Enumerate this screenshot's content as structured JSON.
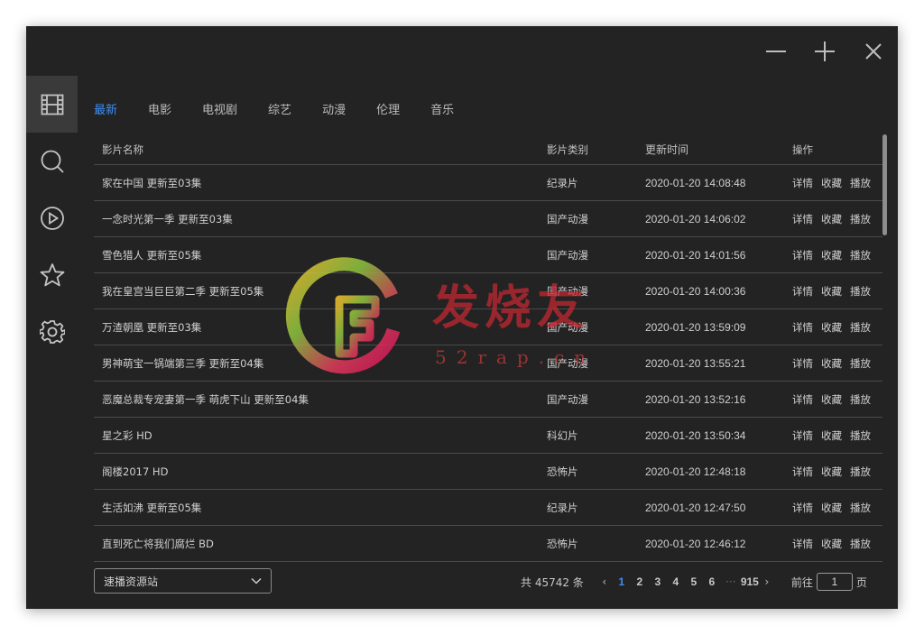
{
  "window_controls": [
    {
      "name": "minimize",
      "icon": "minus-icon"
    },
    {
      "name": "maximize",
      "icon": "plus-icon"
    },
    {
      "name": "close",
      "icon": "close-icon"
    }
  ],
  "sidebar": {
    "items": [
      {
        "id": "library",
        "icon": "film-grid-icon",
        "active": true
      },
      {
        "id": "search",
        "icon": "search-icon",
        "active": false
      },
      {
        "id": "play",
        "icon": "play-circle-icon",
        "active": false
      },
      {
        "id": "favorites",
        "icon": "star-icon",
        "active": false
      },
      {
        "id": "settings",
        "icon": "gear-icon",
        "active": false
      }
    ]
  },
  "tabs": [
    {
      "label": "最新",
      "active": true
    },
    {
      "label": "电影",
      "active": false
    },
    {
      "label": "电视剧",
      "active": false
    },
    {
      "label": "综艺",
      "active": false
    },
    {
      "label": "动漫",
      "active": false
    },
    {
      "label": "伦理",
      "active": false
    },
    {
      "label": "音乐",
      "active": false
    }
  ],
  "table": {
    "headers": {
      "name": "影片名称",
      "category": "影片类别",
      "time": "更新时间",
      "ops": "操作"
    },
    "ops": {
      "detail": "详情",
      "favorite": "收藏",
      "play": "播放"
    },
    "rows": [
      {
        "name": "家在中国 更新至03集",
        "category": "纪录片",
        "time": "2020-01-20 14:08:48"
      },
      {
        "name": "一念时光第一季 更新至03集",
        "category": "国产动漫",
        "time": "2020-01-20 14:06:02"
      },
      {
        "name": "雪色猎人 更新至05集",
        "category": "国产动漫",
        "time": "2020-01-20 14:01:56"
      },
      {
        "name": "我在皇宫当巨巨第二季 更新至05集",
        "category": "国产动漫",
        "time": "2020-01-20 14:00:36"
      },
      {
        "name": "万渣朝凰 更新至03集",
        "category": "国产动漫",
        "time": "2020-01-20 13:59:09"
      },
      {
        "name": "男神萌宝一锅端第三季 更新至04集",
        "category": "国产动漫",
        "time": "2020-01-20 13:55:21"
      },
      {
        "name": "恶魔总裁专宠妻第一季 萌虎下山 更新至04集",
        "category": "国产动漫",
        "time": "2020-01-20 13:52:16"
      },
      {
        "name": "星之彩 HD",
        "category": "科幻片",
        "time": "2020-01-20 13:50:34"
      },
      {
        "name": "阁楼2017 HD",
        "category": "恐怖片",
        "time": "2020-01-20 12:48:18"
      },
      {
        "name": "生活如沸 更新至05集",
        "category": "纪录片",
        "time": "2020-01-20 12:47:50"
      },
      {
        "name": "直到死亡将我们腐烂 BD",
        "category": "恐怖片",
        "time": "2020-01-20 12:46:12"
      }
    ]
  },
  "source_select": {
    "value": "速播资源站",
    "icon": "chevron-down-icon"
  },
  "pagination": {
    "total_text": "共 45742 条",
    "pages": [
      "1",
      "2",
      "3",
      "4",
      "5",
      "6"
    ],
    "current": "1",
    "ellipsis": "···",
    "last_page": "915",
    "goto_label": "前往",
    "goto_value": "1",
    "page_suffix": "页"
  },
  "watermark": {
    "text": "发烧友",
    "subtext": "52rap.cn"
  },
  "colors": {
    "accent": "#3d8ef5",
    "window_bg": "#232323",
    "sidebar_active": "#3a3a3a"
  }
}
